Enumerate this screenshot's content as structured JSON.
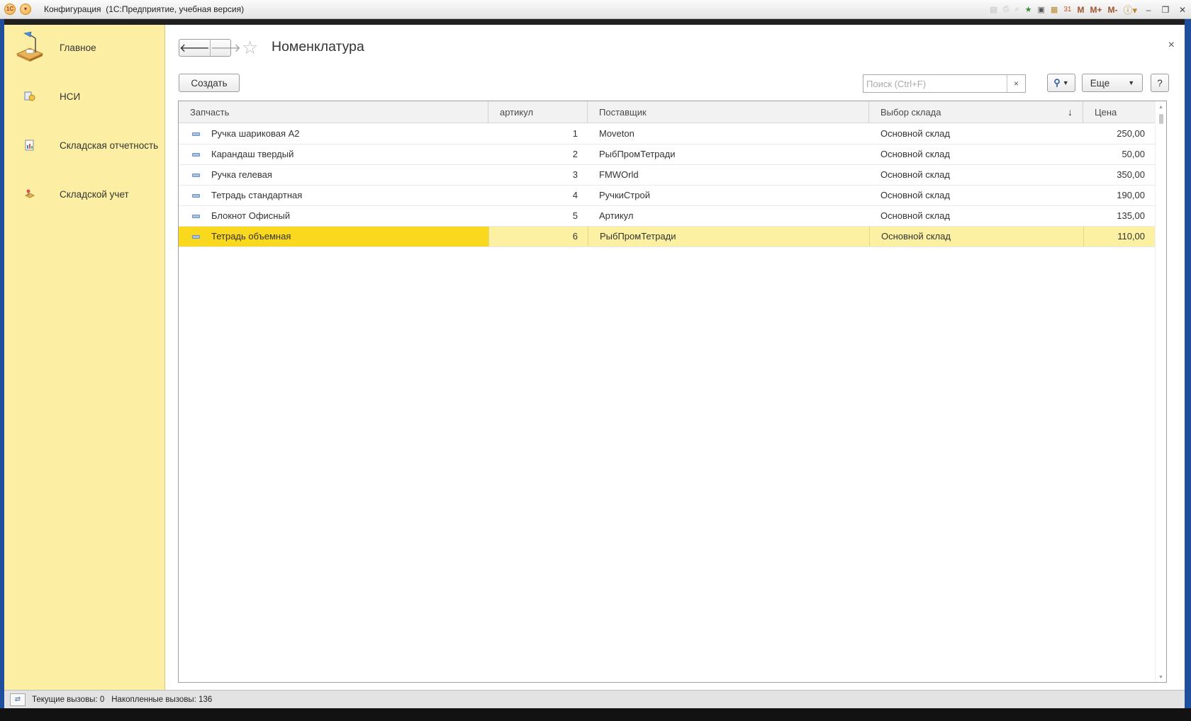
{
  "window": {
    "title": "Конфигурация  (1С:Предприятие, учебная версия)",
    "toolbar_icons": [
      "save-icon",
      "print-icon",
      "preview-icon",
      "favorites-icon",
      "history-icon",
      "calculator-icon",
      "calendar-icon"
    ],
    "memory_buttons": [
      "M",
      "M+",
      "M-"
    ]
  },
  "sidebar": {
    "items": [
      {
        "label": "Главное",
        "icon": "desk-lamp-icon"
      },
      {
        "label": "НСИ",
        "icon": "reference-data-icon"
      },
      {
        "label": "Складская отчетность",
        "icon": "report-icon"
      },
      {
        "label": "Складской учет",
        "icon": "warehouse-accounting-icon"
      }
    ]
  },
  "page": {
    "title": "Номенклатура",
    "close_label": "×"
  },
  "toolbar": {
    "create_label": "Создать",
    "search_placeholder": "Поиск (Ctrl+F)",
    "search_clear": "×",
    "more_label": "Еще",
    "help_label": "?"
  },
  "table": {
    "columns": [
      "Запчасть",
      "артикул",
      "Поставщик",
      "Выбор склада",
      "Цена"
    ],
    "sort_indicator": "↓",
    "rows": [
      {
        "part": "Ручка шариковая А2",
        "article": "1",
        "supplier": "Moveton",
        "warehouse": "Основной склад",
        "price": "250,00"
      },
      {
        "part": "Карандаш твердый",
        "article": "2",
        "supplier": "РыбПромТетради",
        "warehouse": "Основной склад",
        "price": "50,00"
      },
      {
        "part": "Ручка гелевая",
        "article": "3",
        "supplier": "FMWOrld",
        "warehouse": "Основной склад",
        "price": "350,00"
      },
      {
        "part": "Тетрадь стандартная",
        "article": "4",
        "supplier": "РучкиСтрой",
        "warehouse": "Основной склад",
        "price": "190,00"
      },
      {
        "part": "Блокнот Офисный",
        "article": "5",
        "supplier": "Артикул",
        "warehouse": "Основной склад",
        "price": "135,00"
      },
      {
        "part": "Тетрадь объемная",
        "article": "6",
        "supplier": "РыбПромТетради",
        "warehouse": "Основной склад",
        "price": "110,00"
      }
    ],
    "selected_row": 5
  },
  "statusbar": {
    "current_calls": "Текущие вызовы: 0",
    "accumulated_calls": "Накопленные вызовы: 136"
  },
  "colors": {
    "sidebar_bg": "#fcefa3",
    "selected_row": "#fcf0a3",
    "selected_cell": "#fad81e",
    "desktop_blue": "#1f4e9c"
  }
}
